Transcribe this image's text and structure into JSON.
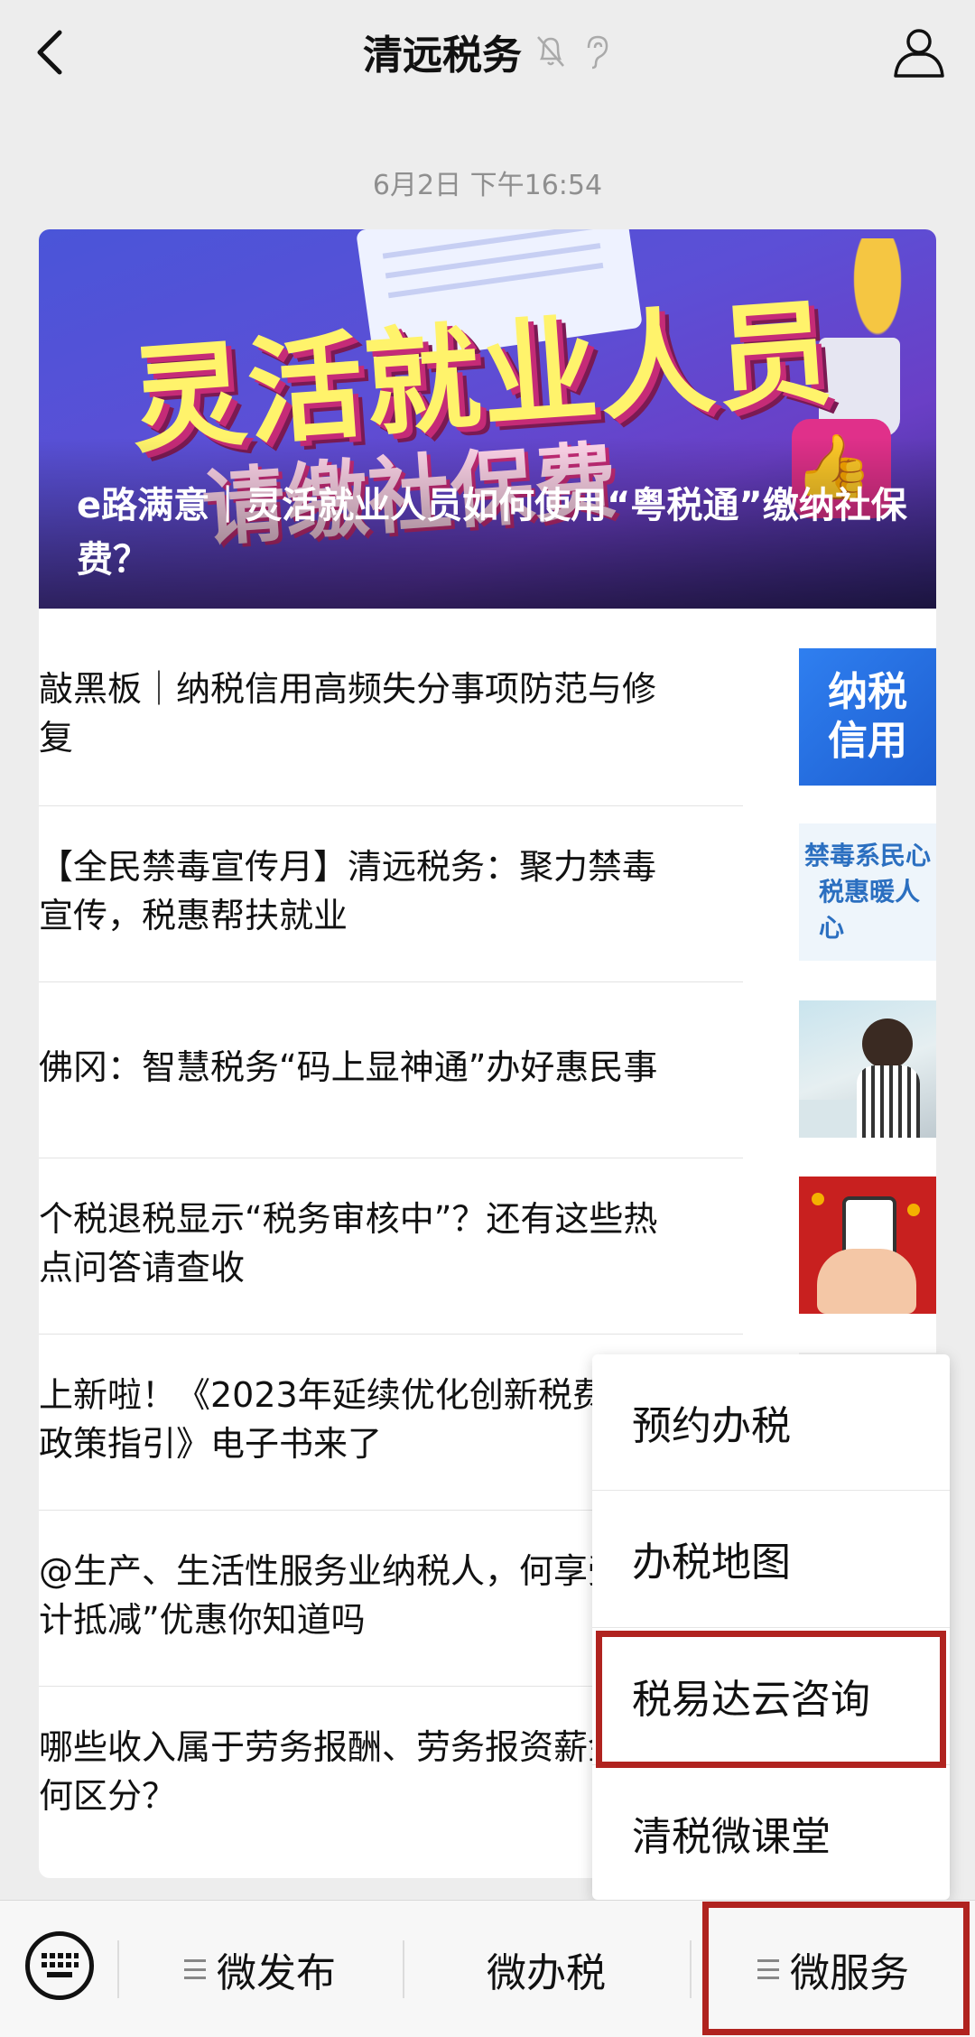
{
  "header": {
    "title": "清远税务"
  },
  "timestamp": "6月2日 下午16:54",
  "featured": {
    "banner_text_line1": "灵活就业人员",
    "banner_text_line2": "请缴社保费",
    "title": "e路满意｜灵活就业人员如何使用“粤税通”缴纳社保费？"
  },
  "articles": [
    {
      "title": "敲黑板｜纳税信用高频失分事项防范与修复",
      "thumb_text": [
        "纳税",
        "信用"
      ]
    },
    {
      "title": "【全民禁毒宣传月】清远税务：聚力禁毒宣传，税惠帮扶就业",
      "thumb_text": [
        "禁毒系民心",
        "税惠暖人心"
      ]
    },
    {
      "title": "佛冈：智慧税务“码上显神通”办好惠民事"
    },
    {
      "title": "个税退税显示“税务审核中”？还有这些热点问答请查收"
    },
    {
      "title": "上新啦！《2023年延续优化创新税费优惠政策指引》电子书来了"
    },
    {
      "title": "@生产、生活性服务业纳税人，何享受“加计抵减”优惠你知道吗"
    },
    {
      "title": "哪些收入属于劳务报酬、劳务报资薪金如何区分？"
    }
  ],
  "popup_menu": {
    "items": [
      "预约办税",
      "办税地图",
      "税易达云咨询",
      "清税微课堂"
    ],
    "highlighted_index": 2
  },
  "bottom_bar": {
    "tabs": [
      "微发布",
      "微办税",
      "微服务"
    ],
    "highlighted_tab": "微服务"
  },
  "colors": {
    "highlight": "#b0231f",
    "background": "#ededed"
  }
}
